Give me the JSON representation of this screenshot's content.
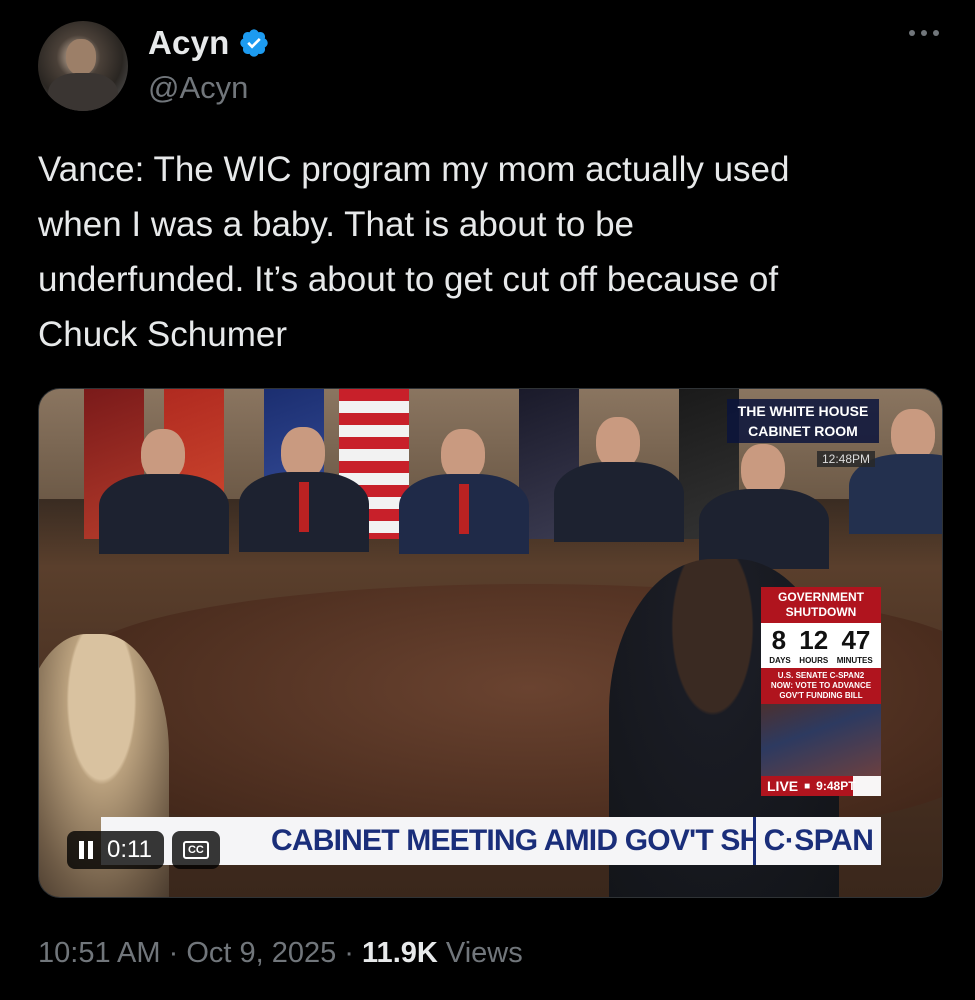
{
  "author": {
    "display_name": "Acyn",
    "handle": "@Acyn",
    "verified_color": "#1d9bf0"
  },
  "more_icon": "more-horizontal-icon",
  "tweet": {
    "text": "Vance: The WIC program my mom actually used\nwhen I was a baby. That is about to be\nunderfunded. It’s about to get cut off because of\nChuck Schumer"
  },
  "video": {
    "location_label": "THE WHITE HOUSE\nCABINET ROOM",
    "location_time": "12:48PM",
    "shutdown": {
      "title": "GOVERNMENT\nSHUTDOWN",
      "days": "8",
      "hours": "12",
      "minutes": "47",
      "days_label": "DAYS",
      "hours_label": "HOURS",
      "minutes_label": "MINUTES",
      "senate_label": "U.S. SENATE C-SPAN2\nNOW: VOTE TO ADVANCE\nGOV'T FUNDING BILL",
      "live_label": "LIVE",
      "live_time": "9:48PT"
    },
    "chyron": "CABINET MEETING AMID GOV'T SHUTDOWN",
    "brand": "C·SPAN",
    "elapsed": "0:11",
    "cc_label": "CC"
  },
  "meta": {
    "time": "10:51 AM",
    "sep1": " · ",
    "date": "Oct 9, 2025",
    "sep2": " · ",
    "views_count": "11.9K",
    "views_label": " Views"
  }
}
